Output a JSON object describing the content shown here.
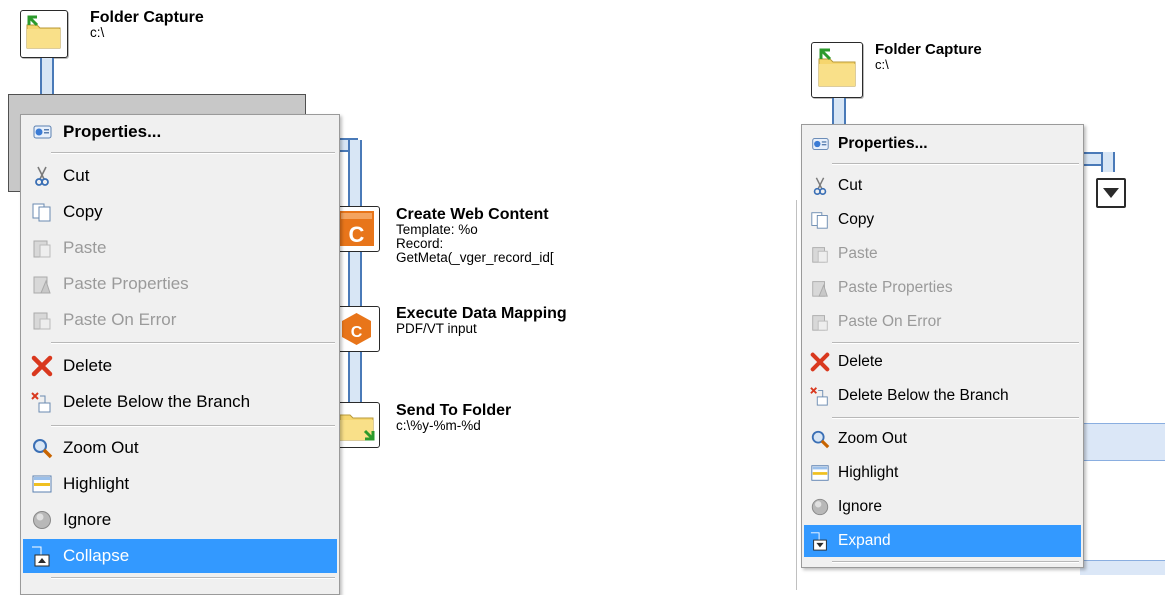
{
  "left": {
    "root": {
      "title": "Folder Capture",
      "path": "c:\\"
    },
    "tasks": [
      {
        "title": "Create Web Content",
        "lines": [
          "Template: %o",
          "Record:",
          "GetMeta(_vger_record_id["
        ]
      },
      {
        "title": "Execute Data Mapping",
        "lines": [
          "PDF/VT input"
        ]
      },
      {
        "title": "Send To Folder",
        "lines": [
          "c:\\%y-%m-%d"
        ]
      }
    ],
    "menu": {
      "items": [
        {
          "label": "Properties...",
          "icon": "properties-icon",
          "state": "bold"
        },
        {
          "label": "Cut",
          "icon": "scissors-icon",
          "state": "enabled"
        },
        {
          "label": "Copy",
          "icon": "copy-icon",
          "state": "enabled"
        },
        {
          "label": "Paste",
          "icon": "paste-icon",
          "state": "disabled"
        },
        {
          "label": "Paste Properties",
          "icon": "paste-properties-icon",
          "state": "disabled"
        },
        {
          "label": "Paste On Error",
          "icon": "paste-on-error-icon",
          "state": "disabled"
        },
        {
          "label": "Delete",
          "icon": "delete-x-icon",
          "state": "enabled"
        },
        {
          "label": "Delete Below the Branch",
          "icon": "delete-below-icon",
          "state": "enabled"
        },
        {
          "label": "Zoom Out",
          "icon": "magnifier-icon",
          "state": "enabled"
        },
        {
          "label": "Highlight",
          "icon": "highlight-icon",
          "state": "enabled"
        },
        {
          "label": "Ignore",
          "icon": "ignore-circle-icon",
          "state": "enabled"
        },
        {
          "label": "Collapse",
          "icon": "collapse-icon",
          "state": "highlighted"
        }
      ]
    }
  },
  "right": {
    "root": {
      "title": "Folder Capture",
      "path": "c:\\"
    },
    "menu": {
      "items": [
        {
          "label": "Properties...",
          "icon": "properties-icon",
          "state": "bold"
        },
        {
          "label": "Cut",
          "icon": "scissors-icon",
          "state": "enabled"
        },
        {
          "label": "Copy",
          "icon": "copy-icon",
          "state": "enabled"
        },
        {
          "label": "Paste",
          "icon": "paste-icon",
          "state": "disabled"
        },
        {
          "label": "Paste Properties",
          "icon": "paste-properties-icon",
          "state": "disabled"
        },
        {
          "label": "Paste On Error",
          "icon": "paste-on-error-icon",
          "state": "disabled"
        },
        {
          "label": "Delete",
          "icon": "delete-x-icon",
          "state": "enabled"
        },
        {
          "label": "Delete Below the Branch",
          "icon": "delete-below-icon",
          "state": "enabled"
        },
        {
          "label": "Zoom Out",
          "icon": "magnifier-icon",
          "state": "enabled"
        },
        {
          "label": "Highlight",
          "icon": "highlight-icon",
          "state": "enabled"
        },
        {
          "label": "Ignore",
          "icon": "ignore-circle-icon",
          "state": "enabled"
        },
        {
          "label": "Expand",
          "icon": "expand-icon",
          "state": "highlighted"
        }
      ]
    }
  },
  "colors": {
    "highlight": "#3399ff",
    "tube_border": "#4a7ab8",
    "tube_fill": "#d8e6f5",
    "menu_bg": "#f0f0f0",
    "task_orange": "#e8751a"
  }
}
